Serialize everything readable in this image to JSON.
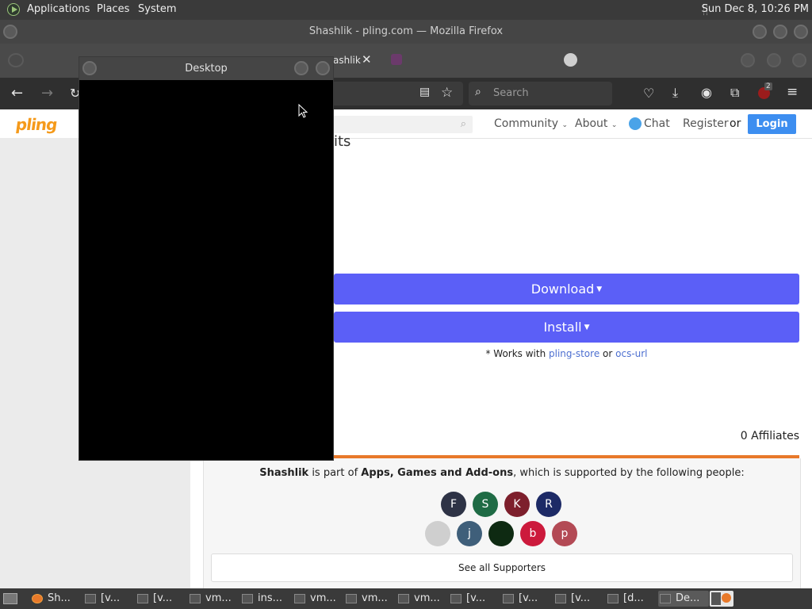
{
  "top_panel": {
    "menus": [
      "Applications",
      "Places",
      "System"
    ],
    "clock": "Sun Dec  8, 10:26 PM"
  },
  "firefox": {
    "window_title": "Shashlik - pling.com — Mozilla Firefox",
    "active_tab_label": "ashlik",
    "search_placeholder": "Search",
    "badge_count": "2"
  },
  "site": {
    "logo_text": "pling",
    "nav": {
      "community": "Community",
      "about": "About",
      "chat": "Chat",
      "register": "Register",
      "or": "or",
      "login": "Login"
    },
    "partial_heading": "its",
    "download_label": "Download",
    "install_label": "Install",
    "works_with_prefix": "* Works with ",
    "pling_store": "pling-store",
    "or": " or ",
    "ocs_url": "ocs-url",
    "affiliates": "0 Affiliates",
    "supporters_text": {
      "product": "Shashlik",
      "is_part_of": " is part of ",
      "category": "Apps, Games and Add-ons",
      "suffix": ", which is supported by the following people:"
    },
    "supporters_row1": [
      {
        "letter": "F",
        "color": "#2e3346"
      },
      {
        "letter": "S",
        "color": "#1f6b45"
      },
      {
        "letter": "K",
        "color": "#7d1f2c"
      },
      {
        "letter": "R",
        "color": "#1d2a66"
      }
    ],
    "supporters_row2": [
      {
        "letter": "",
        "color": "#cfcfcf"
      },
      {
        "letter": "j",
        "color": "#3f5f7a"
      },
      {
        "letter": "",
        "color": "#0e2a12"
      },
      {
        "letter": "b",
        "color": "#cc1a3c"
      },
      {
        "letter": "p",
        "color": "#b34a55"
      }
    ],
    "see_all": "See all Supporters"
  },
  "desktop_window": {
    "title": "Desktop"
  },
  "taskbar": {
    "items": [
      "Sh...",
      "[v...",
      "[v...",
      "vm...",
      "ins...",
      "vm...",
      "vm...",
      "vm...",
      "[v...",
      "[v...",
      "[v...",
      "[d...",
      "De..."
    ]
  },
  "colors": {
    "accent": "#5b5ff7",
    "login": "#3d8ef0",
    "orange": "#e8792a"
  }
}
